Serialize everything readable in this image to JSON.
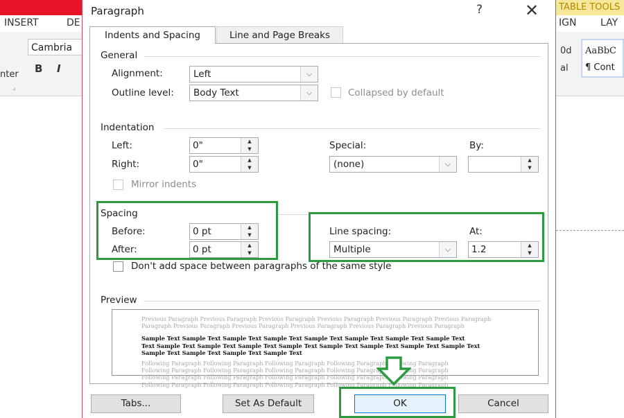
{
  "background": {
    "ribbon_tabs": [
      "INSERT",
      "DE",
      "IGN",
      "LAY"
    ],
    "table_tools": "TABLE TOOLS",
    "font_name": "Cambria",
    "format_buttons": [
      "B",
      "I"
    ],
    "style_samples": [
      "AaBbC",
      "0d",
      "¶ Cont",
      "al"
    ],
    "left_cut_label": "nter"
  },
  "dialog": {
    "title": "Paragraph",
    "help": "?",
    "close": "✕",
    "tabs": [
      "Indents and Spacing",
      "Line and Page Breaks"
    ],
    "general": {
      "heading": "General",
      "alignment_label": "Alignment:",
      "alignment_value": "Left",
      "outline_label": "Outline level:",
      "outline_value": "Body Text",
      "collapsed_label": "Collapsed by default"
    },
    "indentation": {
      "heading": "Indentation",
      "left_label": "Left:",
      "left_value": "0\"",
      "right_label": "Right:",
      "right_value": "0\"",
      "special_label": "Special:",
      "special_value": "(none)",
      "by_label": "By:",
      "by_value": "",
      "mirror_label": "Mirror indents"
    },
    "spacing": {
      "heading": "Spacing",
      "before_label": "Before:",
      "before_value": "0 pt",
      "after_label": "After:",
      "after_value": "0 pt",
      "line_spacing_label": "Line spacing:",
      "line_spacing_value": "Multiple",
      "at_label": "At:",
      "at_value": "1.2",
      "dont_add_label": "Don't add space between paragraphs of the same style"
    },
    "preview": {
      "heading": "Preview",
      "previous_lines": [
        "Previous Paragraph Previous Paragraph Previous Paragraph Previous Paragraph Previous Paragraph Previous Paragraph",
        "Paragraph Previous Paragraph Previous Paragraph Previous Paragraph Previous Paragraph Previous Paragraph"
      ],
      "sample_lines": [
        "Sample Text Sample Text Sample Text Sample Text Sample Text Sample Text Sample Text Sample Text",
        "Text Sample Text Sample Text Sample Text Sample Text Sample Text Sample Text Sample Text Sample Text",
        "Sample Text Sample Text Sample Text Sample Text"
      ],
      "following_lines": [
        "Following Paragraph Following Paragraph Following Paragraph Following Paragraph Following Paragraph",
        "Following Paragraph Following Paragraph Following Paragraph Following Paragraph Following Paragraph",
        "Following Paragraph Following Paragraph Following Paragraph Following Paragraph Following Paragraph",
        "Following Paragraph Following Paragraph Following Paragraph Following Paragraph Following Paragraph"
      ]
    },
    "buttons": {
      "tabs": "Tabs...",
      "set_default": "Set As Default",
      "ok": "OK",
      "cancel": "Cancel"
    },
    "highlight_color": "#2c9a3f"
  }
}
